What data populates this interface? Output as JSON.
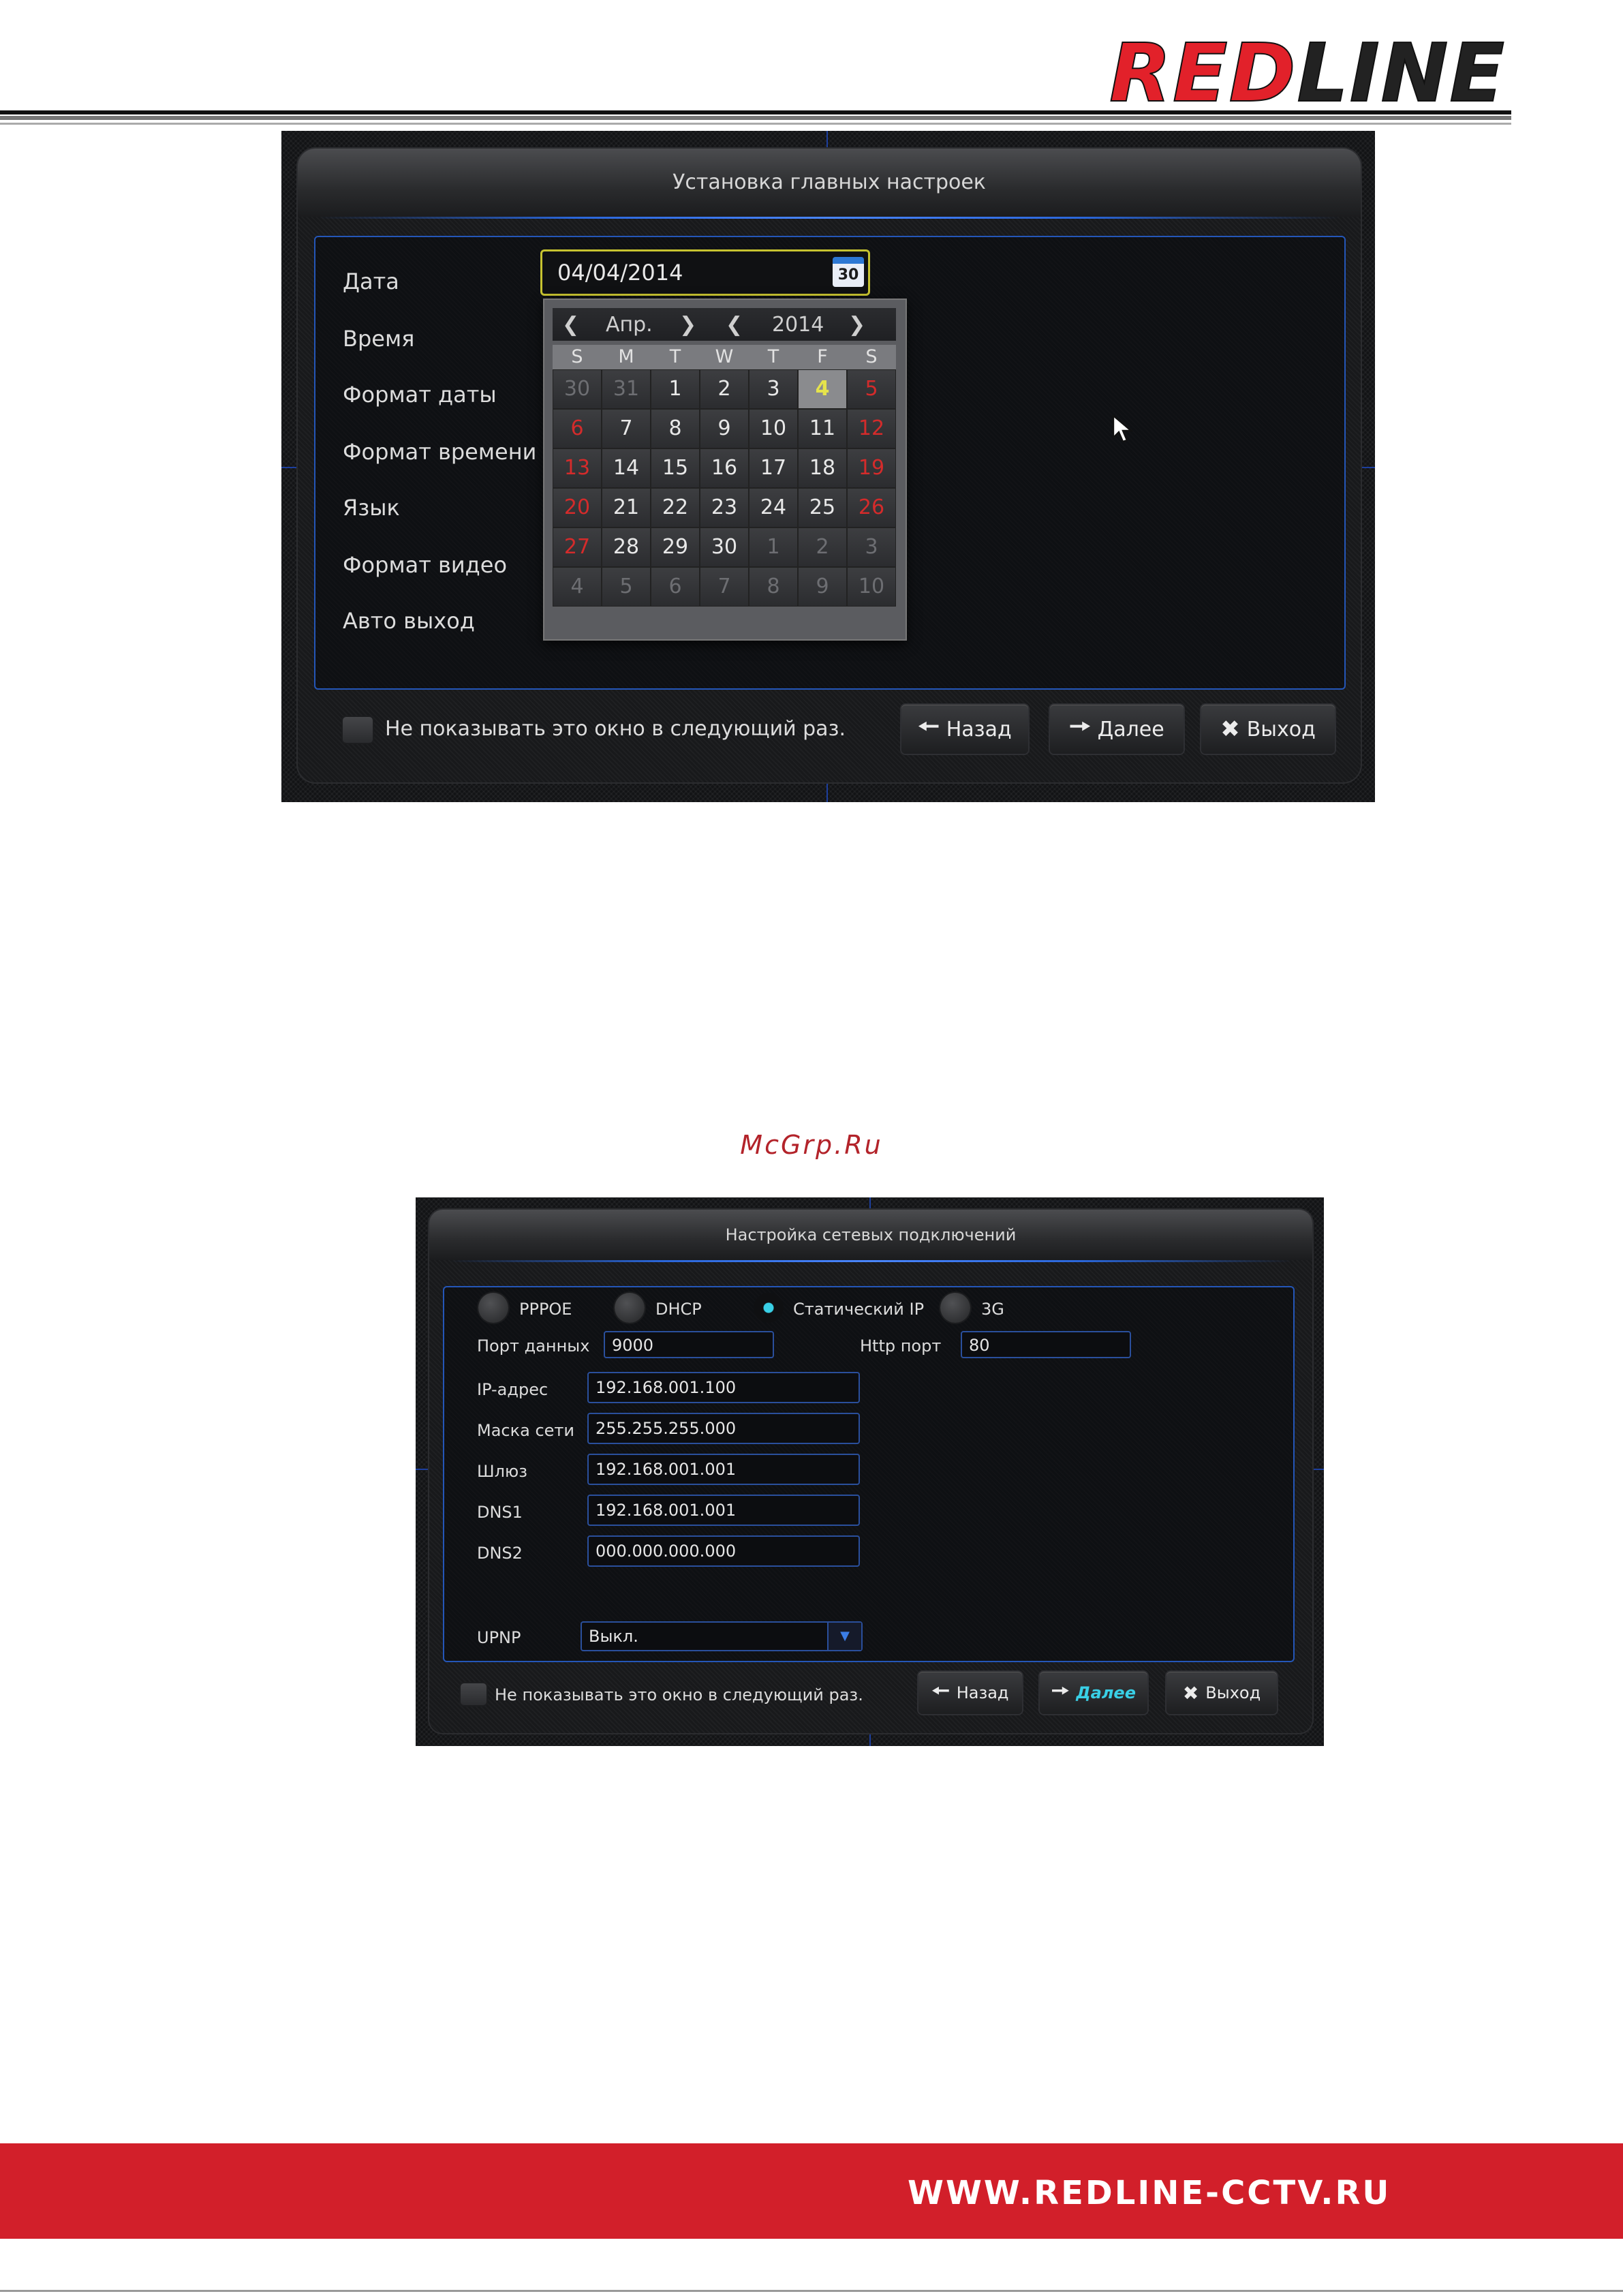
{
  "brand": {
    "part1": "RED",
    "part2": "LINE"
  },
  "watermark": "McGrp.Ru",
  "footer": {
    "url": "WWW.REDLINE-CCTV.RU"
  },
  "icons": {
    "calendar": "calendar-icon",
    "back": "arrow-left-icon",
    "next": "arrow-right-icon",
    "exit": "close-icon",
    "cursor": "mouse-pointer-icon"
  },
  "colors": {
    "brand_red": "#e2212a",
    "footer_red": "#d21f2a",
    "accent_blue": "#2456b8",
    "highlight_yellow": "#c7c330",
    "weekend_red": "#d42b2b",
    "active_cyan": "#39d0e6"
  },
  "screen1": {
    "title": "Установка главных настроек",
    "labels": [
      "Дата",
      "Время",
      "Формат даты",
      "Формат времени",
      "Язык",
      "Формат видео",
      "Авто выход"
    ],
    "date_value": "04/04/2014",
    "calendar_icon_text": "30",
    "calendar": {
      "month": "Апр.",
      "year": "2014",
      "weekdays": [
        "S",
        "M",
        "T",
        "W",
        "T",
        "F",
        "S"
      ],
      "days": [
        [
          "30",
          "31",
          "1",
          "2",
          "3",
          "4",
          "5"
        ],
        [
          "6",
          "7",
          "8",
          "9",
          "10",
          "11",
          "12"
        ],
        [
          "13",
          "14",
          "15",
          "16",
          "17",
          "18",
          "19"
        ],
        [
          "20",
          "21",
          "22",
          "23",
          "24",
          "25",
          "26"
        ],
        [
          "27",
          "28",
          "29",
          "30",
          "1",
          "2",
          "3"
        ],
        [
          "4",
          "5",
          "6",
          "7",
          "8",
          "9",
          "10"
        ]
      ],
      "selected": "4"
    },
    "checkbox_label": "Не показывать это окно в следующий раз.",
    "buttons": {
      "back": "Назад",
      "next": "Далее",
      "exit": "Выход"
    }
  },
  "screen2": {
    "title": "Настройка сетевых подключений",
    "modes": [
      "PPPOE",
      "DHCP",
      "Статический IP",
      "3G"
    ],
    "selected_mode": "Статический IP",
    "data_port_label": "Порт данных",
    "data_port_value": "9000",
    "http_port_label": "Http порт",
    "http_port_value": "80",
    "fields": [
      {
        "label": "IP-адрес",
        "value": "192.168.001.100"
      },
      {
        "label": "Маска сети",
        "value": "255.255.255.000"
      },
      {
        "label": "Шлюз",
        "value": "192.168.001.001"
      },
      {
        "label": "DNS1",
        "value": "192.168.001.001"
      },
      {
        "label": "DNS2",
        "value": "000.000.000.000"
      }
    ],
    "upnp_label": "UPNP",
    "upnp_value": "Выкл.",
    "checkbox_label": "Не показывать это окно в следующий раз.",
    "buttons": {
      "back": "Назад",
      "next": "Далее",
      "exit": "Выход"
    }
  }
}
